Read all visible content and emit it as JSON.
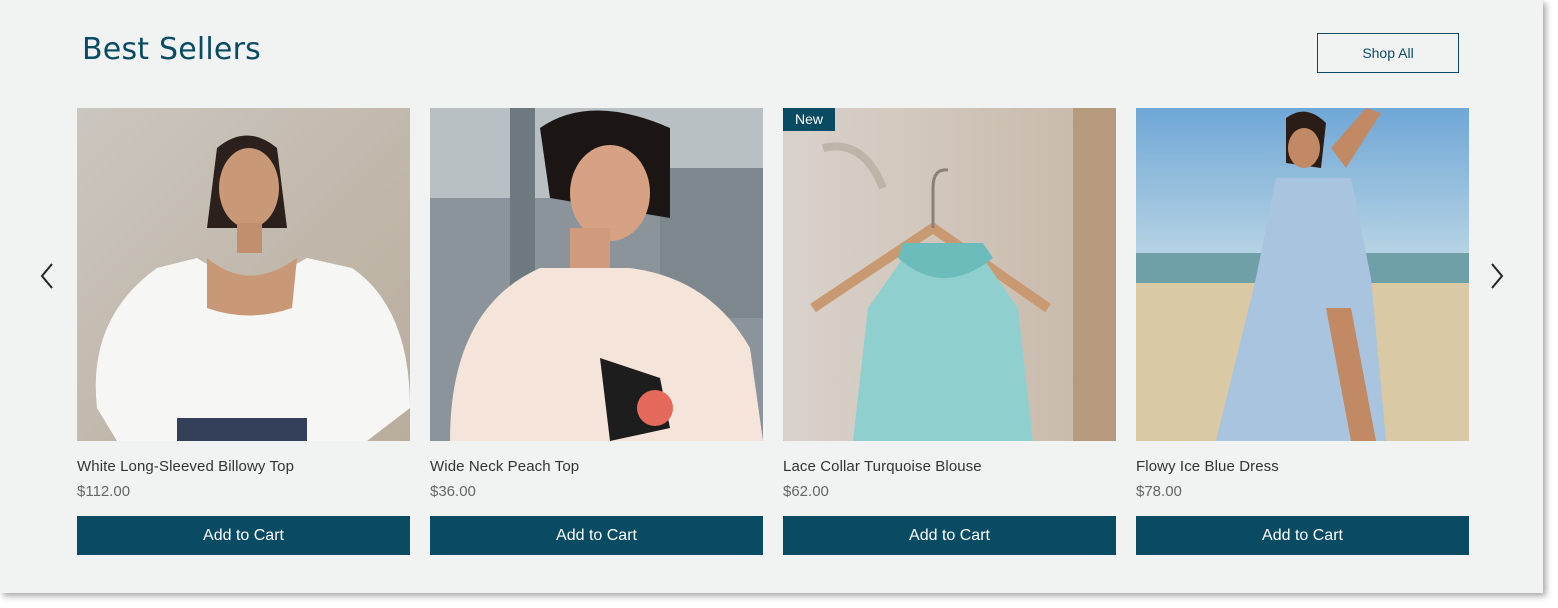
{
  "section": {
    "title": "Best Sellers",
    "shop_all_label": "Shop All"
  },
  "carousel": {
    "prev_icon": "chevron-left-icon",
    "next_icon": "chevron-right-icon"
  },
  "colors": {
    "accent": "#0a4b64",
    "background": "#f1f2f2"
  },
  "products": [
    {
      "name": "White Long-Sleeved Billowy Top",
      "price": "$112.00",
      "button": "Add to Cart",
      "badge": ""
    },
    {
      "name": "Wide Neck Peach Top",
      "price": "$36.00",
      "button": "Add to Cart",
      "badge": ""
    },
    {
      "name": "Lace Collar Turquoise Blouse",
      "price": "$62.00",
      "button": "Add to Cart",
      "badge": "New"
    },
    {
      "name": "Flowy Ice Blue Dress",
      "price": "$78.00",
      "button": "Add to Cart",
      "badge": ""
    }
  ]
}
